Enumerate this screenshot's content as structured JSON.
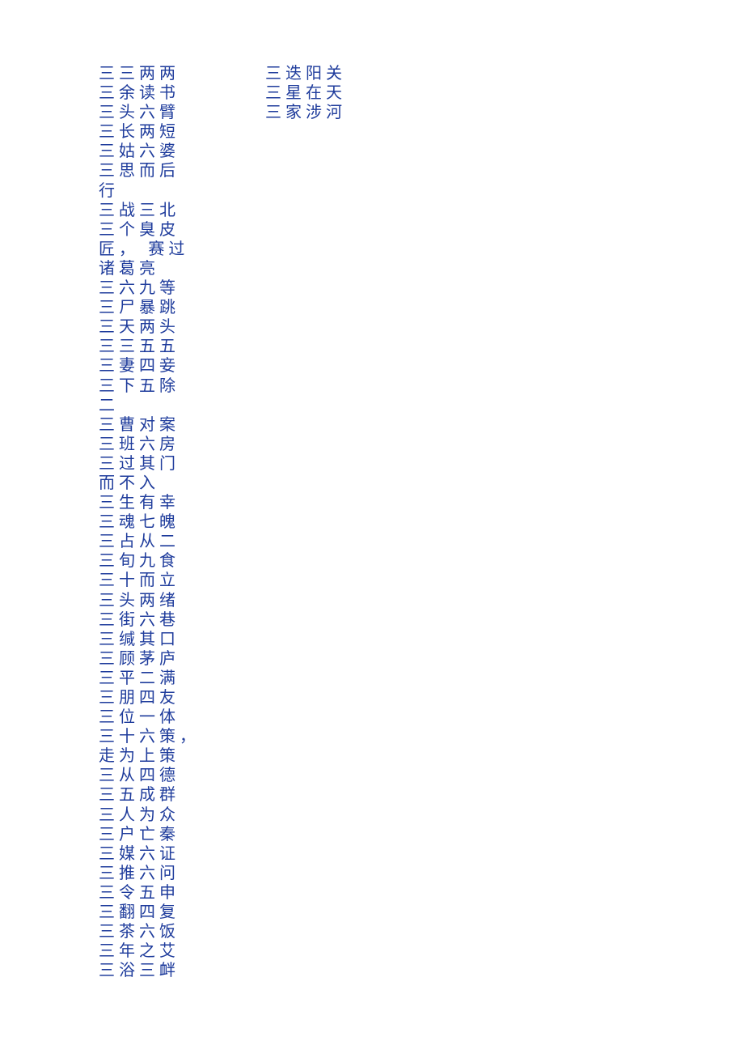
{
  "text_color": "#1f3c9c",
  "columns": [
    {
      "items": [
        {
          "lines": [
            "三三两两"
          ]
        },
        {
          "lines": [
            "三余读书"
          ]
        },
        {
          "lines": [
            "三头六臂"
          ]
        },
        {
          "lines": [
            "三长两短"
          ]
        },
        {
          "lines": [
            "三姑六婆"
          ]
        },
        {
          "lines": [
            "三思而后",
            "行"
          ]
        },
        {
          "lines": [
            "三战三北"
          ]
        },
        {
          "lines": [
            "三个臭皮",
            "匠， 赛过",
            "诸葛亮"
          ]
        },
        {
          "lines": [
            "三六九等"
          ]
        },
        {
          "lines": [
            "三尸暴跳"
          ]
        },
        {
          "lines": [
            "三天两头"
          ]
        },
        {
          "lines": [
            "三三五五"
          ]
        },
        {
          "lines": [
            "三妻四妾"
          ]
        },
        {
          "lines": [
            "三下五除",
            "二"
          ]
        },
        {
          "lines": [
            "三曹对案"
          ]
        },
        {
          "lines": [
            "三班六房"
          ]
        },
        {
          "lines": [
            "三过其门",
            "而不入"
          ]
        },
        {
          "lines": [
            "三生有幸"
          ]
        },
        {
          "lines": [
            "三魂七魄"
          ]
        },
        {
          "lines": [
            "三占从二"
          ]
        },
        {
          "lines": [
            "三旬九食"
          ]
        },
        {
          "lines": [
            "三十而立"
          ]
        },
        {
          "lines": [
            "三头两绪"
          ]
        },
        {
          "lines": [
            "三街六巷"
          ]
        },
        {
          "lines": [
            "三缄其口"
          ]
        },
        {
          "lines": [
            "三顾茅庐"
          ]
        },
        {
          "lines": [
            "三平二满"
          ]
        },
        {
          "lines": [
            "三朋四友"
          ]
        },
        {
          "lines": [
            "三位一体"
          ]
        },
        {
          "lines": [
            "三十六策，",
            "走为上策"
          ]
        },
        {
          "lines": [
            "三从四德"
          ]
        },
        {
          "lines": [
            "三五成群"
          ]
        },
        {
          "lines": [
            "三人为众"
          ]
        },
        {
          "lines": [
            "三户亡秦"
          ]
        },
        {
          "lines": [
            "三媒六证"
          ]
        },
        {
          "lines": [
            "三推六问"
          ]
        },
        {
          "lines": [
            "三令五申"
          ]
        },
        {
          "lines": [
            "三翻四复"
          ]
        },
        {
          "lines": [
            "三茶六饭"
          ]
        },
        {
          "lines": [
            "三年之艾"
          ]
        },
        {
          "lines": [
            "三浴三衅"
          ]
        }
      ]
    },
    {
      "items": [
        {
          "lines": [
            "三迭阳关"
          ]
        },
        {
          "lines": [
            "三星在天"
          ]
        },
        {
          "lines": [
            "三家涉河"
          ]
        }
      ]
    }
  ]
}
